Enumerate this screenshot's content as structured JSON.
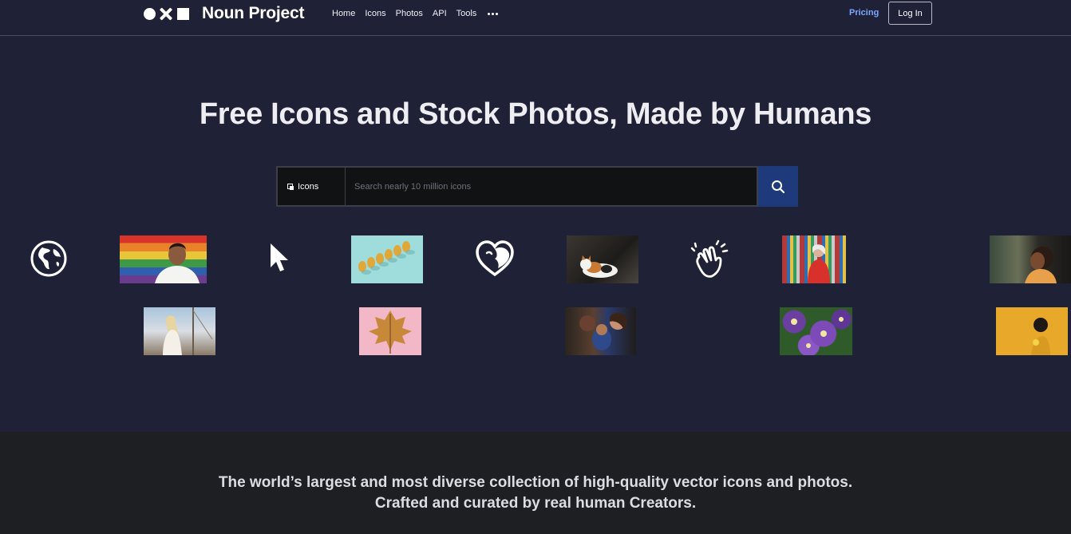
{
  "header": {
    "brand": "Noun Project",
    "nav": [
      "Home",
      "Icons",
      "Photos",
      "API",
      "Tools"
    ],
    "pricing_label": "Pricing",
    "login_label": "Log In"
  },
  "hero": {
    "title": "Free Icons and Stock Photos, Made by Humans",
    "search_type_label": "Icons",
    "search_placeholder": "Search nearly 10 million icons"
  },
  "tiles": [
    {
      "kind": "icon",
      "name": "globe-icon"
    },
    {
      "kind": "photo",
      "name": "man-rainbow-flag-photo"
    },
    {
      "kind": "icon",
      "name": "cursor-arrow-icon"
    },
    {
      "kind": "photo",
      "name": "pears-photo"
    },
    {
      "kind": "icon",
      "name": "heart-face-icon"
    },
    {
      "kind": "photo",
      "name": "cat-photo"
    },
    {
      "kind": "icon",
      "name": "clapping-hands-icon"
    },
    {
      "kind": "photo",
      "name": "woman-mural-photo"
    },
    {
      "kind": "photo",
      "name": "woman-portrait-photo"
    },
    {
      "kind": "photo",
      "name": "woman-boat-photo"
    },
    {
      "kind": "photo",
      "name": "autumn-leaf-photo"
    },
    {
      "kind": "photo",
      "name": "family-baby-photo"
    },
    {
      "kind": "photo",
      "name": "purple-flowers-photo"
    },
    {
      "kind": "photo",
      "name": "yellow-background-photo"
    }
  ],
  "tagline": {
    "line1": "The world’s largest and most diverse collection of high-quality vector icons and photos.",
    "line2": "Crafted and curated by real human Creators."
  },
  "colors": {
    "background": "#1f2236",
    "search_button": "#1e3a7a",
    "pricing": "#7aa7ff",
    "band": "#1e1f23"
  }
}
